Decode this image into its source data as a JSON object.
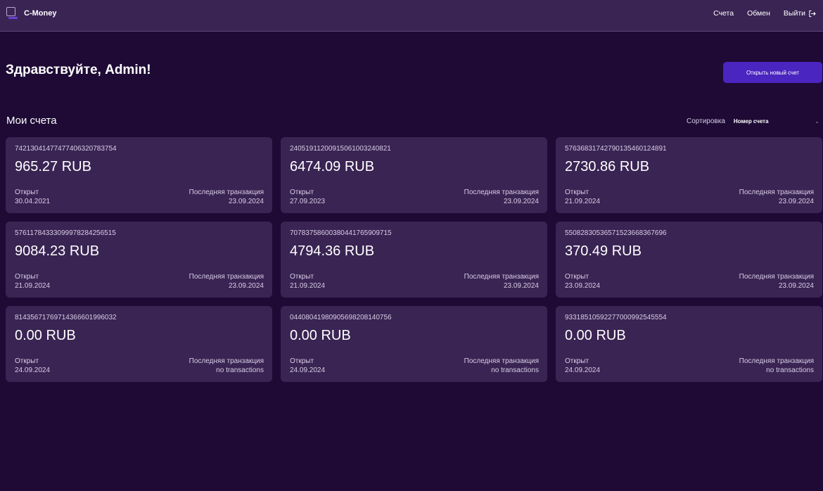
{
  "header": {
    "app_name": "C-Money",
    "nav": {
      "accounts": "Счета",
      "exchange": "Обмен",
      "logout": "Выйти"
    }
  },
  "main": {
    "greeting": "Здравствуйте, Admin!",
    "open_account_button": "Открыть новый счет",
    "section_title": "Мои счета",
    "sort": {
      "label": "Сортировка",
      "selected": "Номер счета"
    }
  },
  "labels": {
    "opened": "Открыт",
    "last_transaction": "Последняя транзакция"
  },
  "accounts": [
    {
      "number": "74213041477477406320783754",
      "balance": "965.27 RUB",
      "opened": "30.04.2021",
      "last_transaction": "23.09.2024"
    },
    {
      "number": "24051911200915061003240821",
      "balance": "6474.09 RUB",
      "opened": "27.09.2023",
      "last_transaction": "23.09.2024"
    },
    {
      "number": "57636831742790135460124891",
      "balance": "2730.86 RUB",
      "opened": "21.09.2024",
      "last_transaction": "23.09.2024"
    },
    {
      "number": "57611784333099978284256515",
      "balance": "9084.23 RUB",
      "opened": "21.09.2024",
      "last_transaction": "23.09.2024"
    },
    {
      "number": "70783758600380441765909715",
      "balance": "4794.36 RUB",
      "opened": "21.09.2024",
      "last_transaction": "23.09.2024"
    },
    {
      "number": "55082830536571523668367696",
      "balance": "370.49 RUB",
      "opened": "23.09.2024",
      "last_transaction": "23.09.2024"
    },
    {
      "number": "81435671769714366601996032",
      "balance": "0.00 RUB",
      "opened": "24.09.2024",
      "last_transaction": "no transactions"
    },
    {
      "number": "04408041980905698208140756",
      "balance": "0.00 RUB",
      "opened": "24.09.2024",
      "last_transaction": "no transactions"
    },
    {
      "number": "93318510592277000992545554",
      "balance": "0.00 RUB",
      "opened": "24.09.2024",
      "last_transaction": "no transactions"
    }
  ]
}
